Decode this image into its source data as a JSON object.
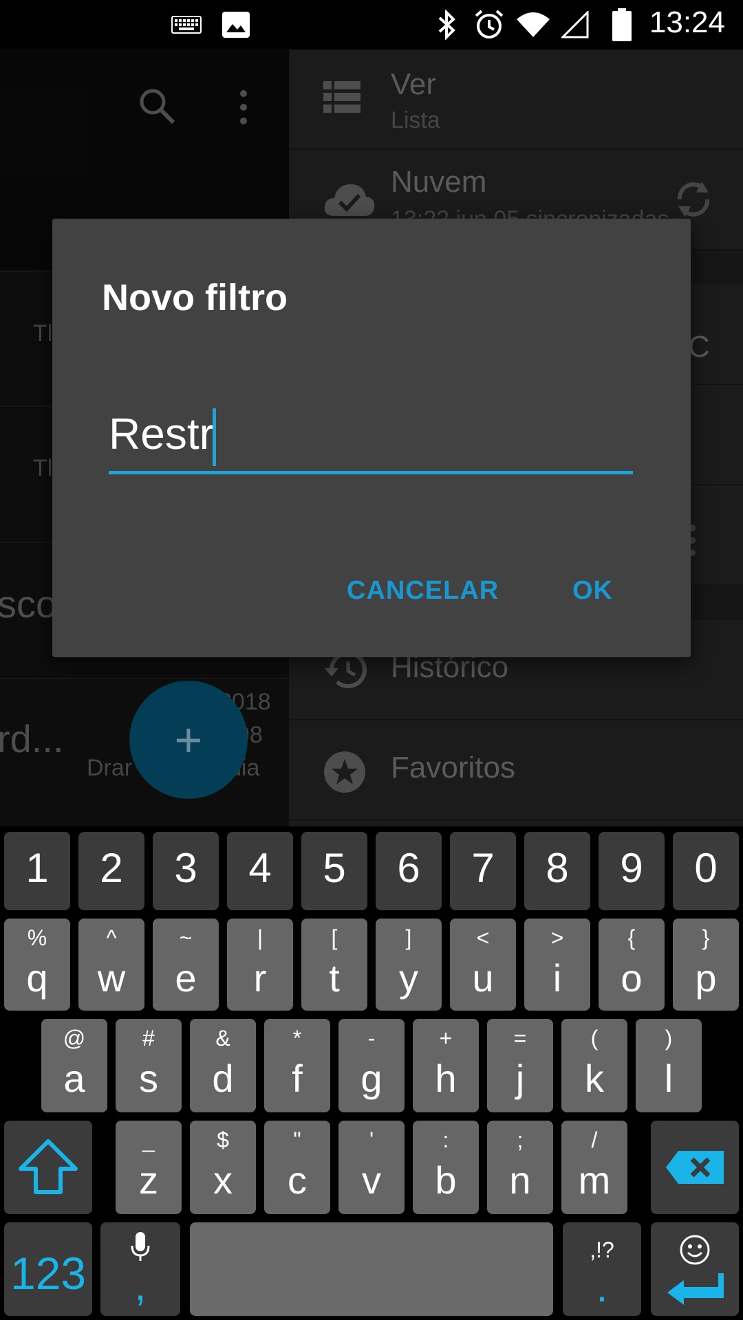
{
  "status_bar": {
    "time": "13:24",
    "icons": [
      "keyboard-icon",
      "image-icon",
      "bluetooth-icon",
      "alarm-icon",
      "wifi-icon",
      "cell-signal-icon",
      "battery-icon"
    ]
  },
  "background": {
    "left_fragments": [
      "Tl",
      "Tl",
      "scob",
      "rd...",
      "2018",
      "98",
      "Drar",
      "dia"
    ],
    "drawer": {
      "view_title": "Ver",
      "view_sub": "Lista",
      "cloud_title": "Nuvem",
      "cloud_sub": "13:22 jun 05 sincronizadas",
      "fragment_c": "C",
      "history": "Histórico",
      "favorites": "Favoritos"
    },
    "fab_label": "+"
  },
  "dialog": {
    "title": "Novo filtro",
    "input_value": "Restr",
    "cancel_label": "CANCELAR",
    "ok_label": "OK",
    "accent_color": "#1fa3d9"
  },
  "keyboard": {
    "numbers": [
      "1",
      "2",
      "3",
      "4",
      "5",
      "6",
      "7",
      "8",
      "9",
      "0"
    ],
    "row1": [
      {
        "k": "q",
        "a": "%"
      },
      {
        "k": "w",
        "a": "^"
      },
      {
        "k": "e",
        "a": "~"
      },
      {
        "k": "r",
        "a": "|"
      },
      {
        "k": "t",
        "a": "["
      },
      {
        "k": "y",
        "a": "]"
      },
      {
        "k": "u",
        "a": "<"
      },
      {
        "k": "i",
        "a": ">"
      },
      {
        "k": "o",
        "a": "{"
      },
      {
        "k": "p",
        "a": "}"
      }
    ],
    "row2": [
      {
        "k": "a",
        "a": "@"
      },
      {
        "k": "s",
        "a": "#"
      },
      {
        "k": "d",
        "a": "&"
      },
      {
        "k": "f",
        "a": "*"
      },
      {
        "k": "g",
        "a": "-"
      },
      {
        "k": "h",
        "a": "+"
      },
      {
        "k": "j",
        "a": "="
      },
      {
        "k": "k",
        "a": "("
      },
      {
        "k": "l",
        "a": ")"
      }
    ],
    "row3": [
      {
        "k": "z",
        "a": "_"
      },
      {
        "k": "x",
        "a": "$"
      },
      {
        "k": "c",
        "a": "\""
      },
      {
        "k": "v",
        "a": "'"
      },
      {
        "k": "b",
        "a": ":"
      },
      {
        "k": "n",
        "a": ";"
      },
      {
        "k": "m",
        "a": "/"
      }
    ],
    "numbers_key": "123",
    "comma_key": ",",
    "punct_key_alt": ",!?",
    "period_key": ".",
    "accent_color": "#1ab4e8"
  }
}
